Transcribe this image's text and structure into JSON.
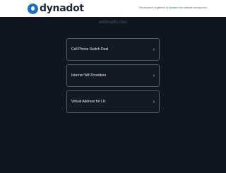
{
  "header": {
    "brand_text": "dynadot",
    "notice_prefix": "This domain is registered at",
    "notice_link": "Dynadot.com",
    "notice_suffix": ". Website coming soon."
  },
  "site": {
    "domain": "webnsoftx.com"
  },
  "links": [
    {
      "label": "Cell Phone Switch Deal"
    },
    {
      "label": "Internet Wifi Providers"
    },
    {
      "label": "Virtual Address for Llc"
    }
  ],
  "footer": {
    "line1": "",
    "line2": ""
  },
  "icons": {
    "brand": "dynadot-logo-icon",
    "chevron": "chevron-right-icon"
  }
}
